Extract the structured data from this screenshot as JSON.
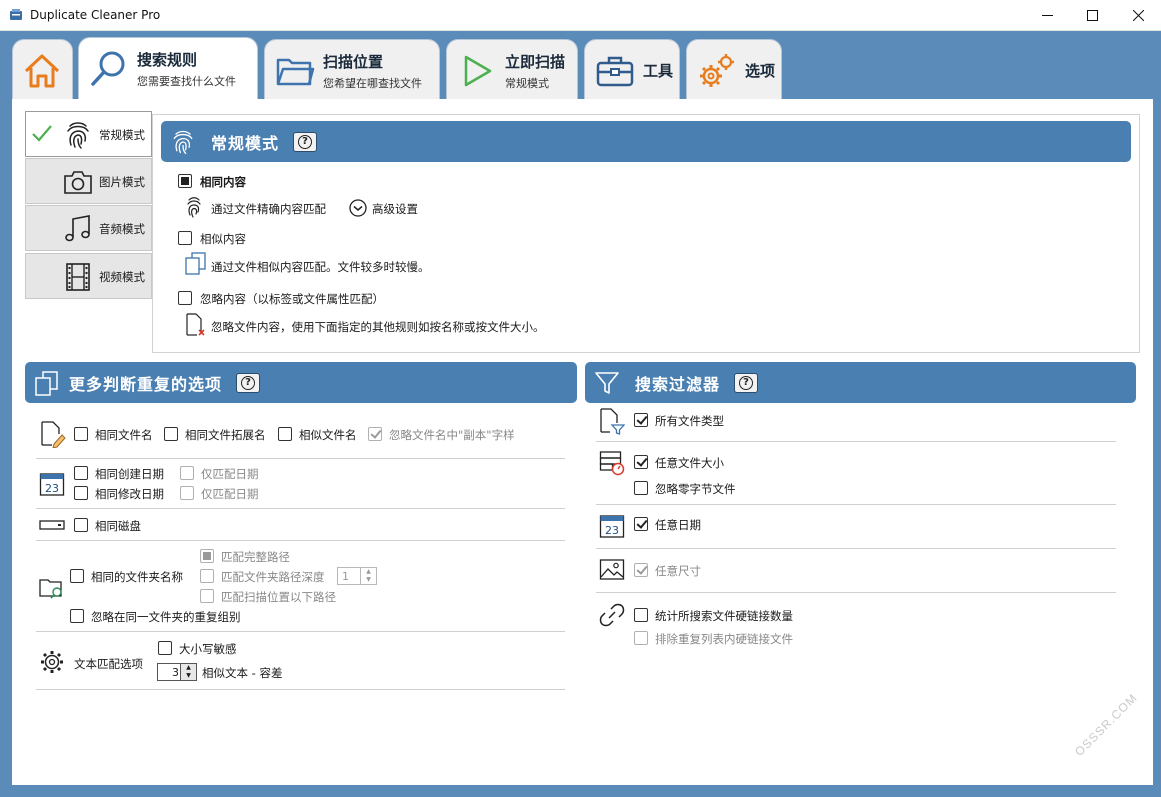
{
  "window": {
    "title": "Duplicate Cleaner Pro"
  },
  "tabs": [
    {
      "title": "",
      "sub": ""
    },
    {
      "title": "搜索规则",
      "sub": "您需要查找什么文件"
    },
    {
      "title": "扫描位置",
      "sub": "您希望在哪查找文件"
    },
    {
      "title": "立即扫描",
      "sub": "常规模式"
    },
    {
      "title": "工具",
      "sub": ""
    },
    {
      "title": "选项",
      "sub": ""
    }
  ],
  "side_modes": [
    {
      "label": "常规模式",
      "active": true
    },
    {
      "label": "图片模式"
    },
    {
      "label": "音频模式"
    },
    {
      "label": "视频模式"
    }
  ],
  "mode_panel": {
    "title": "常规模式",
    "help": "?",
    "same_content": "相同内容",
    "same_content_desc": "通过文件精确内容匹配",
    "advanced": "高级设置",
    "similar_content": "相似内容",
    "similar_content_desc": "通过文件相似内容匹配。文件较多时较慢。",
    "ignore_content": "忽略内容（以标签或文件属性匹配）",
    "ignore_content_desc": "忽略文件内容，使用下面指定的其他规则如按名称或按文件大小。"
  },
  "more_options": {
    "title": "更多判断重复的选项",
    "help": "?",
    "same_name": "相同文件名",
    "same_ext": "相同文件拓展名",
    "similar_name": "相似文件名",
    "ignore_copy": "忽略文件名中\"副本\"字样",
    "same_created": "相同创建日期",
    "same_modified": "相同修改日期",
    "date_only_1": "仅匹配日期",
    "date_only_2": "仅匹配日期",
    "same_disk": "相同磁盘",
    "same_folder_name": "相同的文件夹名称",
    "match_full_path": "匹配完整路径",
    "match_path_depth": "匹配文件夹路径深度",
    "path_depth_value": "1",
    "match_below_scan": "匹配扫描位置以下路径",
    "ignore_same_folder": "忽略在同一文件夹的重复组别",
    "text_match": "文本匹配选项",
    "case_sensitive": "大小写敏感",
    "tolerance_value": "3",
    "similar_text": "相似文本 - 容差"
  },
  "filters": {
    "title": "搜索过滤器",
    "help": "?",
    "all_types": "所有文件类型",
    "any_size": "任意文件大小",
    "ignore_zero": "忽略零字节文件",
    "any_date": "任意日期",
    "any_dimension": "任意尺寸",
    "count_hardlinks": "统计所搜索文件硬链接数量",
    "exclude_hardlinks": "排除重复列表内硬链接文件"
  },
  "watermark": "OSSSR.COM",
  "colors": {
    "accent": "#4a7fb2",
    "frame": "#5b8bb8",
    "home_orange": "#e87d1e",
    "scan_green": "#4caf50"
  }
}
